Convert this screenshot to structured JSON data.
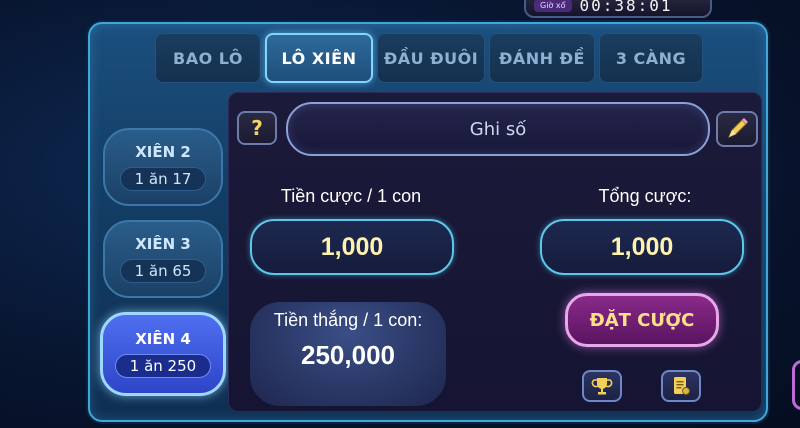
{
  "timer": {
    "label": "Giờ xổ",
    "value": "00:38:01"
  },
  "tabs": [
    {
      "label": "BAO LÔ",
      "active": false
    },
    {
      "label": "LÔ XIÊN",
      "active": true
    },
    {
      "label": "ĐẦU ĐUÔI",
      "active": false
    },
    {
      "label": "ĐÁNH ĐỀ",
      "active": false
    },
    {
      "label": "3 CÀNG",
      "active": false
    }
  ],
  "side": [
    {
      "name": "XIÊN 2",
      "odds": "1 ăn 17",
      "active": false
    },
    {
      "name": "XIÊN 3",
      "odds": "1 ăn 65",
      "active": false
    },
    {
      "name": "XIÊN 4",
      "odds": "1 ăn 250",
      "active": true
    }
  ],
  "help_label": "?",
  "number_input": {
    "placeholder": "Ghi số"
  },
  "bet_per_label": "Tiền cược / 1 con",
  "bet_per_value": "1,000",
  "total_label": "Tổng cược:",
  "total_value": "1,000",
  "win_label": "Tiền thắng / 1 con:",
  "win_value": "250,000",
  "place_bet_label": "ĐẶT CƯỢC",
  "icons": {
    "help": "question-icon",
    "edit": "pencil-icon",
    "rank": "trophy-icon",
    "history": "document-icon"
  }
}
